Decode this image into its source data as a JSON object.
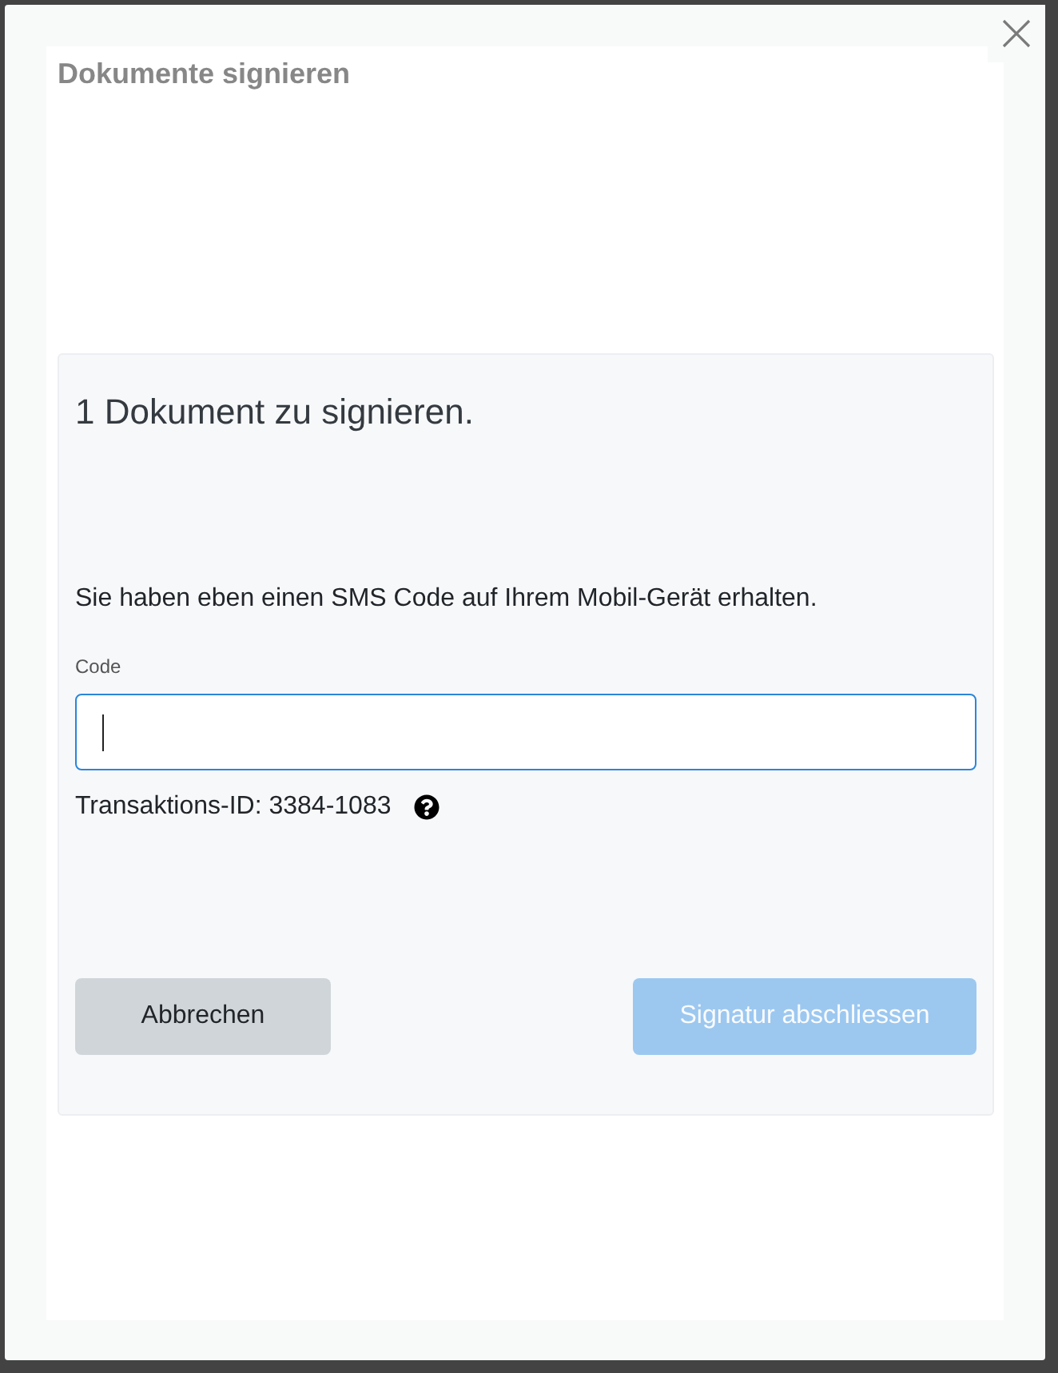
{
  "dialog": {
    "title": "Dokumente signieren"
  },
  "card": {
    "heading": "1 Dokument zu signieren.",
    "message": "Sie haben eben einen SMS Code auf Ihrem Mobil-Gerät erhalten.",
    "code_field": {
      "label": "Code",
      "focused": true
    },
    "transaction": "Transaktions-ID: 3384-1083",
    "buttons": [
      {
        "label": "Abbrechen",
        "kind": "secondary",
        "disabled": false
      },
      {
        "label": "Signatur abschliessen",
        "kind": "primary",
        "disabled": true
      }
    ]
  }
}
